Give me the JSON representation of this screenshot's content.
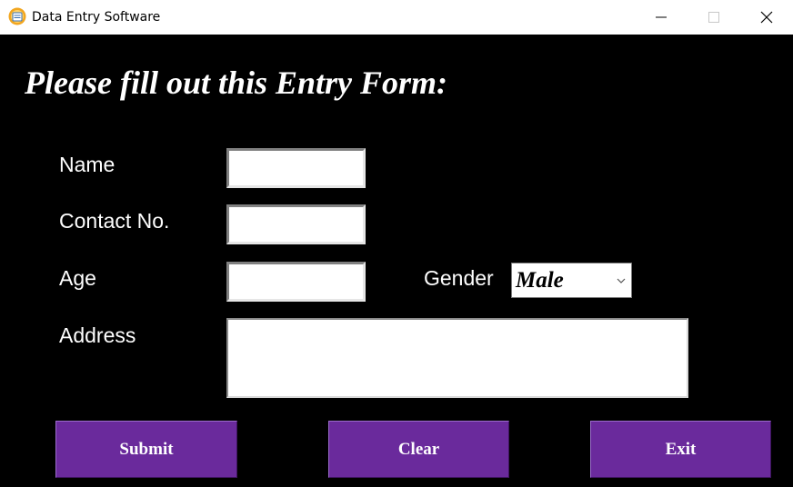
{
  "window": {
    "title": "Data Entry Software",
    "icon": "app-form-icon",
    "controls": [
      "minimize-icon",
      "maximize-icon",
      "close-icon"
    ]
  },
  "form": {
    "heading": "Please fill out this Entry Form:",
    "fields": {
      "name_label": "Name",
      "name_value": "",
      "contact_label": "Contact No.",
      "contact_value": "",
      "age_label": "Age",
      "age_value": "",
      "gender_label": "Gender",
      "gender_value": "Male",
      "address_label": "Address",
      "address_value": ""
    },
    "buttons": {
      "submit": "Submit",
      "clear": "Clear",
      "exit": "Exit"
    }
  },
  "colors": {
    "background": "#000000",
    "button": "#6a2a9c",
    "text": "#ffffff"
  }
}
